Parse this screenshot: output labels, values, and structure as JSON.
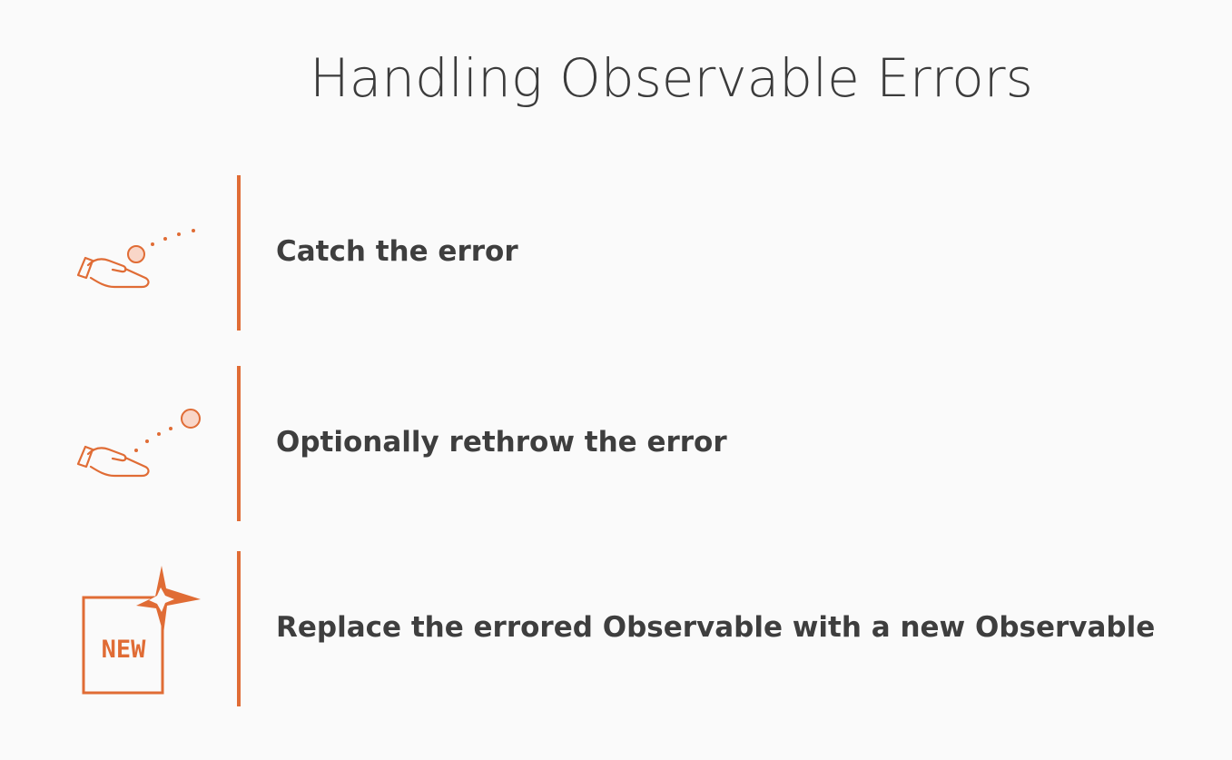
{
  "slide": {
    "title": "Handling Observable Errors",
    "accent_color": "#e06c35",
    "items": [
      {
        "icon": "hand-catch-ball-icon",
        "label": "Catch the error"
      },
      {
        "icon": "hand-throw-ball-icon",
        "label": "Optionally rethrow the error"
      },
      {
        "icon": "new-badge-icon",
        "label": "Replace the errored Observable with a new Observable",
        "badge_text": "NEW"
      }
    ]
  }
}
